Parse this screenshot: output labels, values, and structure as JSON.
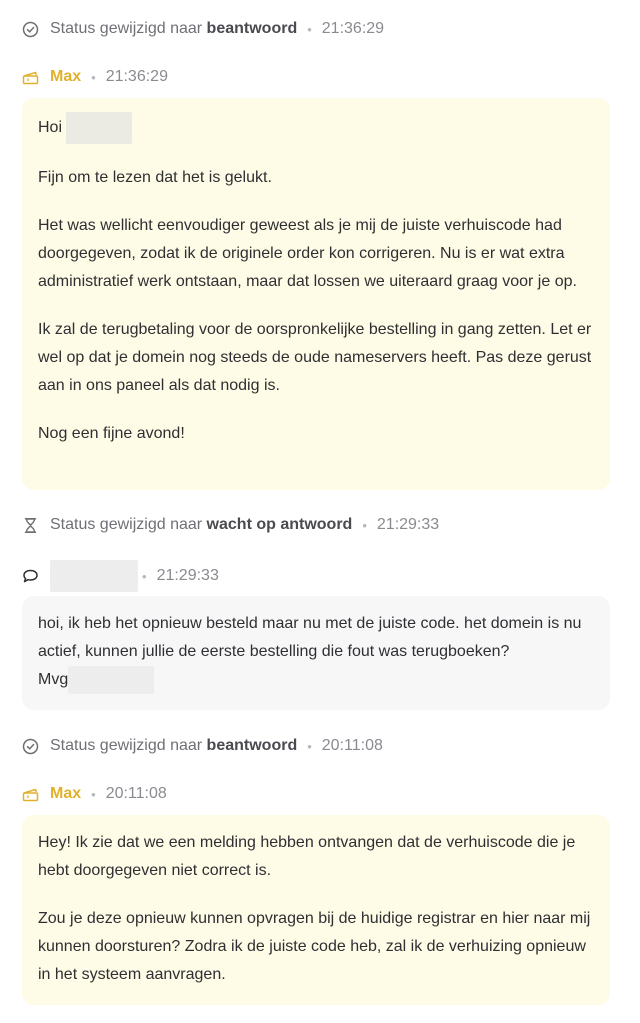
{
  "messages": [
    {
      "type": "status",
      "text": "Status gewijzigd naar",
      "status": "beantwoord",
      "time": "21:36:29",
      "icon": "check-circle-icon"
    },
    {
      "type": "agent",
      "name": "Max",
      "time": "21:36:29",
      "icon": "ticket-icon",
      "greeting": "Hoi",
      "paragraphs": [
        "Fijn om te lezen dat het is gelukt.",
        "Het was wellicht eenvoudiger geweest als je mij de juiste verhuiscode had doorgegeven, zodat ik de originele order kon corrigeren. Nu is er wat extra administratief werk ontstaan, maar dat lossen we uiteraard graag voor je op.",
        "Ik zal de terugbetaling voor de oorspronkelijke bestelling in gang zetten. Let er wel op dat je domein nog steeds de oude nameservers heeft. Pas deze gerust aan in ons paneel als dat nodig is.",
        "Nog een fijne avond!"
      ]
    },
    {
      "type": "status",
      "text": "Status gewijzigd naar",
      "status": "wacht op antwoord",
      "time": "21:29:33",
      "icon": "hourglass-icon"
    },
    {
      "type": "user",
      "time": "21:29:33",
      "icon": "chat-bubble-icon",
      "body": "hoi, ik heb het opnieuw besteld maar nu met de juiste code. het domein is nu actief, kunnen jullie de eerste bestelling die fout was terugboeken?",
      "signoff": "Mvg"
    },
    {
      "type": "status",
      "text": "Status gewijzigd naar",
      "status": "beantwoord",
      "time": "20:11:08",
      "icon": "check-circle-icon"
    },
    {
      "type": "agent",
      "name": "Max",
      "time": "20:11:08",
      "icon": "ticket-icon",
      "paragraphs": [
        "Hey! Ik zie dat we een melding hebben ontvangen dat de verhuiscode die je hebt doorgegeven niet correct is.",
        "Zou je deze opnieuw kunnen opvragen bij de huidige registrar en hier naar mij kunnen doorsturen? Zodra ik de juiste code heb, zal ik de verhuizing opnieuw in het systeem aanvragen."
      ]
    }
  ],
  "colors": {
    "agent_accent": "#e1b12c",
    "agent_bubble": "#fefbe6",
    "user_bubble": "#f7f7f8"
  }
}
